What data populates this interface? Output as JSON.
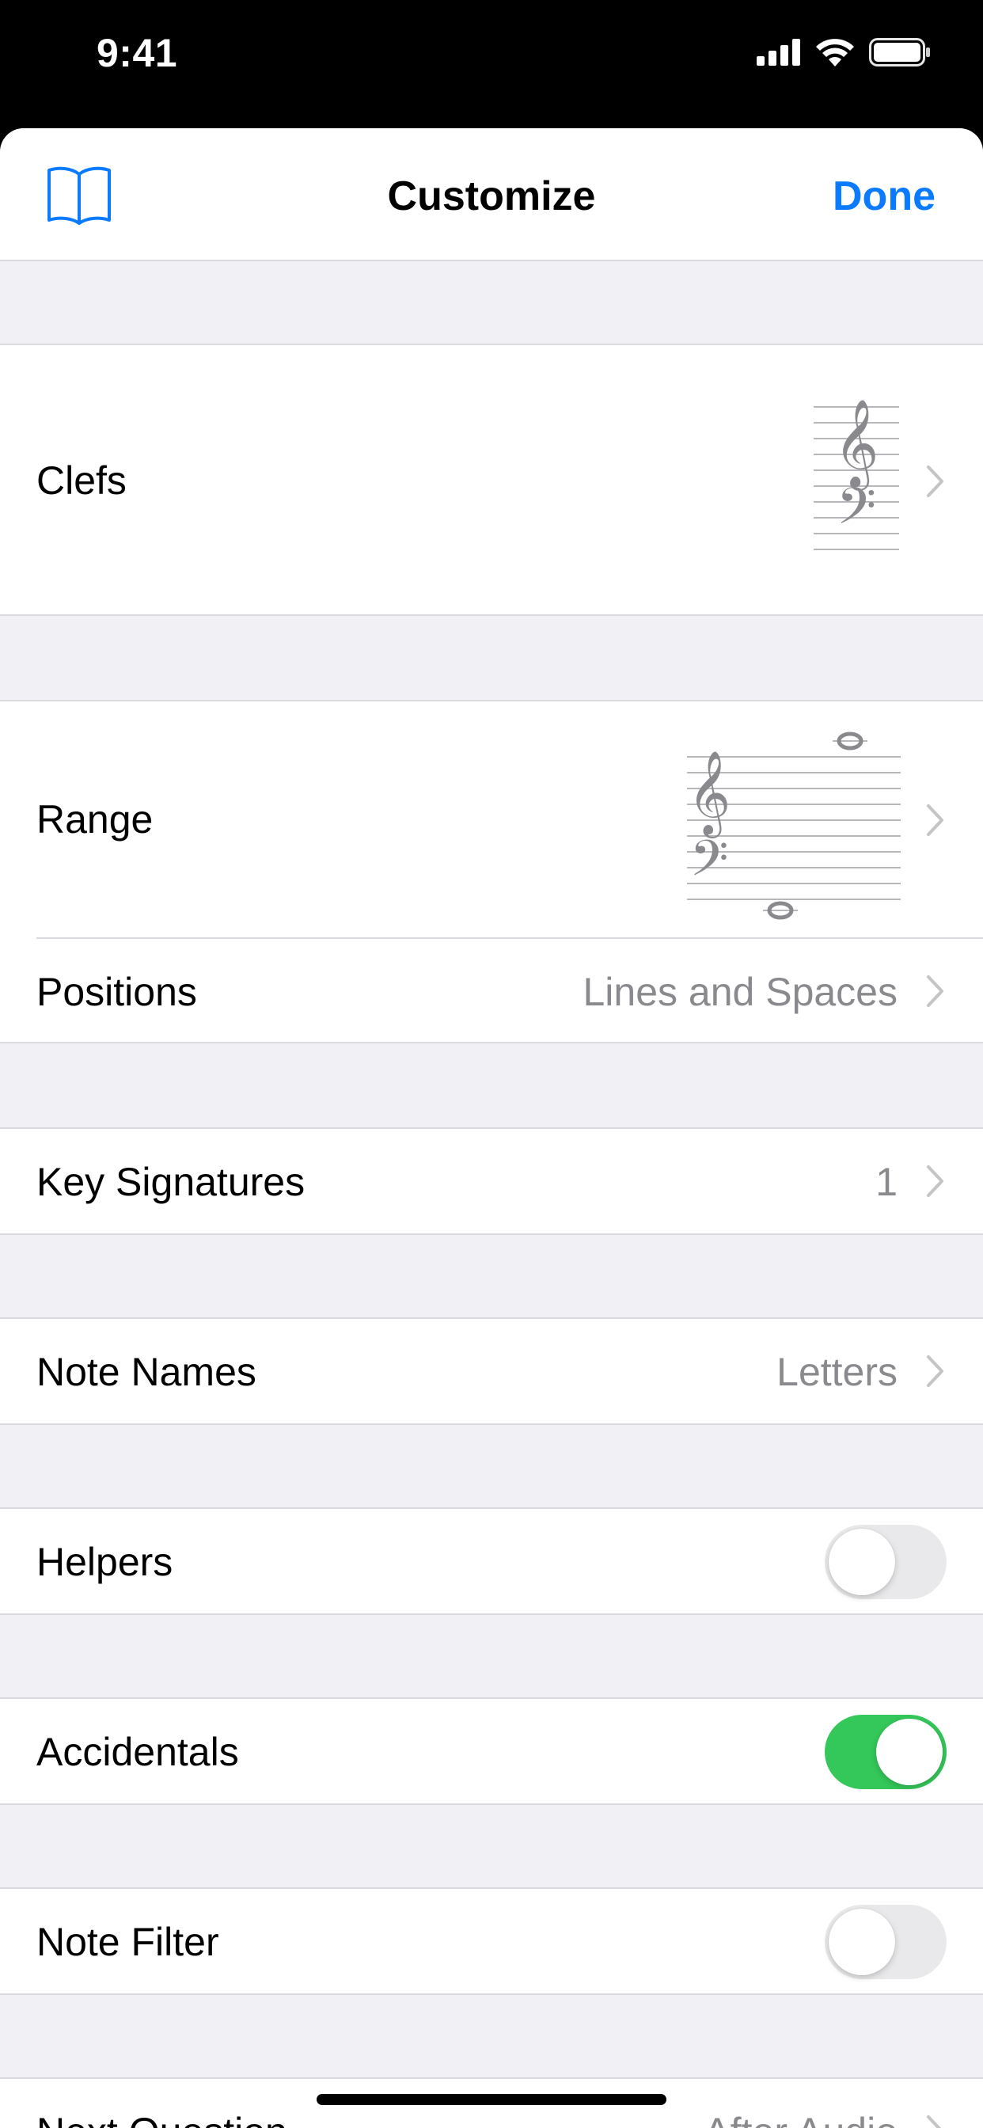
{
  "status_bar": {
    "time": "9:41"
  },
  "nav": {
    "title": "Customize",
    "done_label": "Done",
    "book_icon": "book-icon"
  },
  "rows": {
    "clefs": {
      "label": "Clefs"
    },
    "range": {
      "label": "Range"
    },
    "positions": {
      "label": "Positions",
      "value": "Lines and Spaces"
    },
    "key_signatures": {
      "label": "Key Signatures",
      "value": "1"
    },
    "note_names": {
      "label": "Note Names",
      "value": "Letters"
    },
    "helpers": {
      "label": "Helpers",
      "on": false
    },
    "accidentals": {
      "label": "Accidentals",
      "on": true
    },
    "note_filter": {
      "label": "Note Filter",
      "on": false
    },
    "next_question": {
      "label": "Next Question",
      "value": "After Audio"
    }
  },
  "colors": {
    "accent": "#0a7aff",
    "toggle_on": "#34c759",
    "background": "#f0f0f5"
  }
}
